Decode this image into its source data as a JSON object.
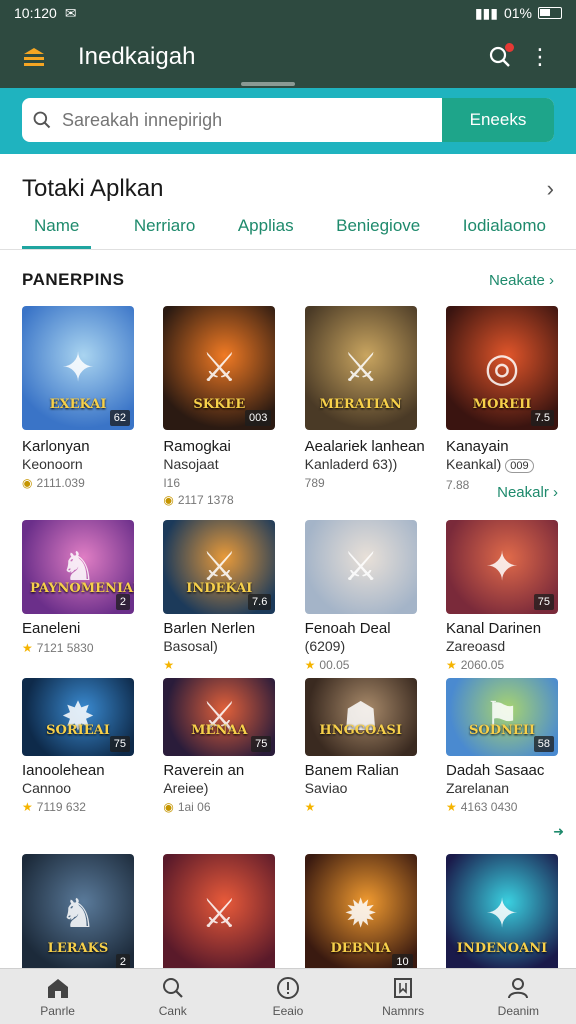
{
  "status": {
    "time": "10:120",
    "battery": "01%"
  },
  "header": {
    "title": "Inedkaigah"
  },
  "search": {
    "placeholder": "Sareakah innepirigh",
    "button": "Eneeks"
  },
  "section": {
    "title": "Totaki Aplkan"
  },
  "tabs": [
    "Name",
    "Nerriaro",
    "Applias",
    "Beniegiove",
    "Iodialaomo"
  ],
  "sub": {
    "title": "PANERPINS",
    "more": "Neakate"
  },
  "rows": [
    [
      {
        "n1": "Karlonyan",
        "n2": "Keonoorn",
        "meta": "2111.039",
        "mark": "coin",
        "badge": "62",
        "banner": "EXEKAI",
        "c1": "#3a74c7",
        "c2": "#a9d4f0",
        "glyph": "✦"
      },
      {
        "n1": "Ramogkai",
        "n2": "Nasojaat",
        "meta": "2117 1378",
        "mark": "coin",
        "extra": "I16",
        "badge": "003",
        "banner": "SKKEE",
        "c1": "#2b1a12",
        "c2": "#f07a24",
        "glyph": "⚔"
      },
      {
        "n1": "Aealariek lanhean",
        "n2": "Kanladerd 63))",
        "meta": "789",
        "mark": "",
        "badge": "",
        "banner": "MERATIAN",
        "c1": "#4a3a26",
        "c2": "#c9a560",
        "glyph": "⚔"
      },
      {
        "n1": "Kanayain",
        "n2": "Keankal)",
        "meta": "7.88",
        "mark": "",
        "pill": "009",
        "badge": "7.5",
        "banner": "MOREII",
        "c1": "#3a1410",
        "c2": "#e0552a",
        "glyph": "◎"
      }
    ],
    [
      {
        "n1": "Eaneleni",
        "n2": "",
        "meta": "7121 5830",
        "mark": "star",
        "badge": "2",
        "banner": "PAYNOMENIAN",
        "c1": "#6b2f8a",
        "c2": "#e07ec4",
        "glyph": "♞"
      },
      {
        "n1": "Barlen Nerlen",
        "n2": "Basosal)",
        "meta": "",
        "mark": "star",
        "badge": "7.6",
        "banner": "INDEKAI",
        "c1": "#1c3a5a",
        "c2": "#e89a3a",
        "glyph": "⚔"
      },
      {
        "n1": "Fenoah Deal",
        "n2": "(6209)",
        "meta": "00.05",
        "mark": "star",
        "badge": "",
        "banner": "",
        "c1": "#a4b4c8",
        "c2": "#e8e0d8",
        "glyph": "⚔"
      },
      {
        "n1": "Kanal Darinen",
        "n2": "Zareoasd",
        "meta": "2060.05",
        "mark": "star",
        "badge": "75",
        "banner": "",
        "c1": "#7a2a3a",
        "c2": "#e06a4a",
        "glyph": "✦"
      }
    ],
    [
      {
        "n1": "Ianoolehean",
        "n2": "Cannoo",
        "meta": "7119 632",
        "mark": "star",
        "badge": "75",
        "banner": "SORIEAI",
        "c1": "#0e2a4a",
        "c2": "#3a8ad0",
        "glyph": "✸"
      },
      {
        "n1": "Raverein an",
        "n2": "Areiee)",
        "meta": "1ai 06",
        "mark": "coin",
        "badge": "75",
        "banner": "MENAA",
        "c1": "#2a1c3a",
        "c2": "#e0603a",
        "glyph": "⚔"
      },
      {
        "n1": "Banem Ralian",
        "n2": "Saviao",
        "meta": "",
        "mark": "star",
        "badge": "",
        "banner": "HNGCOASI",
        "c1": "#3a2a20",
        "c2": "#a88a6a",
        "glyph": "☗"
      },
      {
        "n1": "Dadah Sasaac",
        "n2": "Zarelanan",
        "meta": "4163 0430",
        "mark": "star",
        "badge": "58",
        "banner": "SODNEII",
        "c1": "#4a8ad0",
        "c2": "#a8d470",
        "glyph": "⚑"
      }
    ],
    [
      {
        "n1": "",
        "n2": "",
        "meta": "",
        "mark": "",
        "badge": "2",
        "banner": "LERAKS",
        "c1": "#1c2a3a",
        "c2": "#5a7a9a",
        "glyph": "♞"
      },
      {
        "n1": "",
        "n2": "",
        "meta": "",
        "mark": "",
        "badge": "",
        "banner": "",
        "c1": "#5a1a2a",
        "c2": "#e85a3a",
        "glyph": "⚔"
      },
      {
        "n1": "",
        "n2": "",
        "meta": "",
        "mark": "",
        "badge": "10",
        "banner": "DEBNIA",
        "c1": "#3a1a10",
        "c2": "#f09a30",
        "glyph": "✹"
      },
      {
        "n1": "",
        "n2": "",
        "meta": "",
        "mark": "",
        "badge": "",
        "banner": "INDENOANI",
        "c1": "#1a1a4a",
        "c2": "#3ad0e0",
        "glyph": "✦"
      }
    ]
  ],
  "more_label": "Neakalr",
  "bottom_nav": [
    {
      "label": "Panrle",
      "icon": "home-icon"
    },
    {
      "label": "Cank",
      "icon": "search-icon"
    },
    {
      "label": "Eeaio",
      "icon": "info-icon"
    },
    {
      "label": "Namnrs",
      "icon": "bookmark-icon"
    },
    {
      "label": "Deanim",
      "icon": "profile-icon"
    }
  ]
}
